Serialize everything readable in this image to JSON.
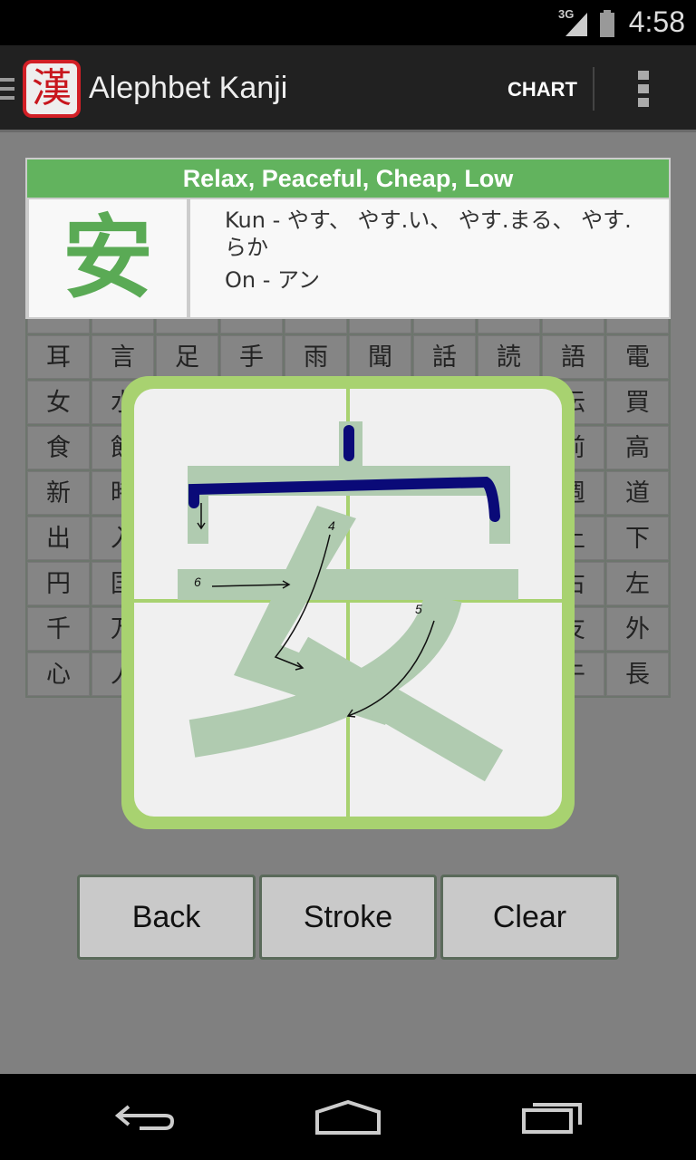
{
  "status": {
    "network": "3G",
    "time": "4:58"
  },
  "appbar": {
    "logo_char": "漢",
    "title": "Alephbet Kanji",
    "chart_label": "CHART"
  },
  "grid": {
    "rows": [
      [
        "",
        "",
        "",
        "",
        "",
        "",
        "",
        "",
        "",
        ""
      ],
      [
        "耳",
        "言",
        "足",
        "手",
        "雨",
        "聞",
        "話",
        "読",
        "語",
        "電"
      ],
      [
        "女",
        "水",
        "",
        "",
        "",
        "",
        "",
        "",
        "伝",
        "買"
      ],
      [
        "食",
        "飲",
        "",
        "",
        "",
        "",
        "",
        "",
        "前",
        "高"
      ],
      [
        "新",
        "時",
        "",
        "",
        "",
        "",
        "",
        "",
        "週",
        "道"
      ],
      [
        "出",
        "入",
        "",
        "",
        "",
        "",
        "",
        "",
        "上",
        "下"
      ],
      [
        "円",
        "国",
        "",
        "",
        "",
        "",
        "",
        "",
        "右",
        "左"
      ],
      [
        "千",
        "万",
        "",
        "",
        "",
        "",
        "",
        "",
        "友",
        "外"
      ],
      [
        "心",
        "人",
        "",
        "",
        "",
        "",
        "",
        "",
        "午",
        "長"
      ]
    ]
  },
  "card": {
    "meaning": "Relax, Peaceful, Cheap, Low",
    "kanji": "安",
    "kun": "Kun - やす、 やす.い、 やす.まる、 やす.らか",
    "on": "On - アン"
  },
  "practice": {
    "stroke_numbers": [
      "4",
      "5",
      "6"
    ]
  },
  "buttons": {
    "back": "Back",
    "stroke": "Stroke",
    "clear": "Clear"
  },
  "colors": {
    "accent": "#62b35e",
    "frame": "#a8d270",
    "trace": "#b0cbb0",
    "ink": "#0a0a78"
  }
}
